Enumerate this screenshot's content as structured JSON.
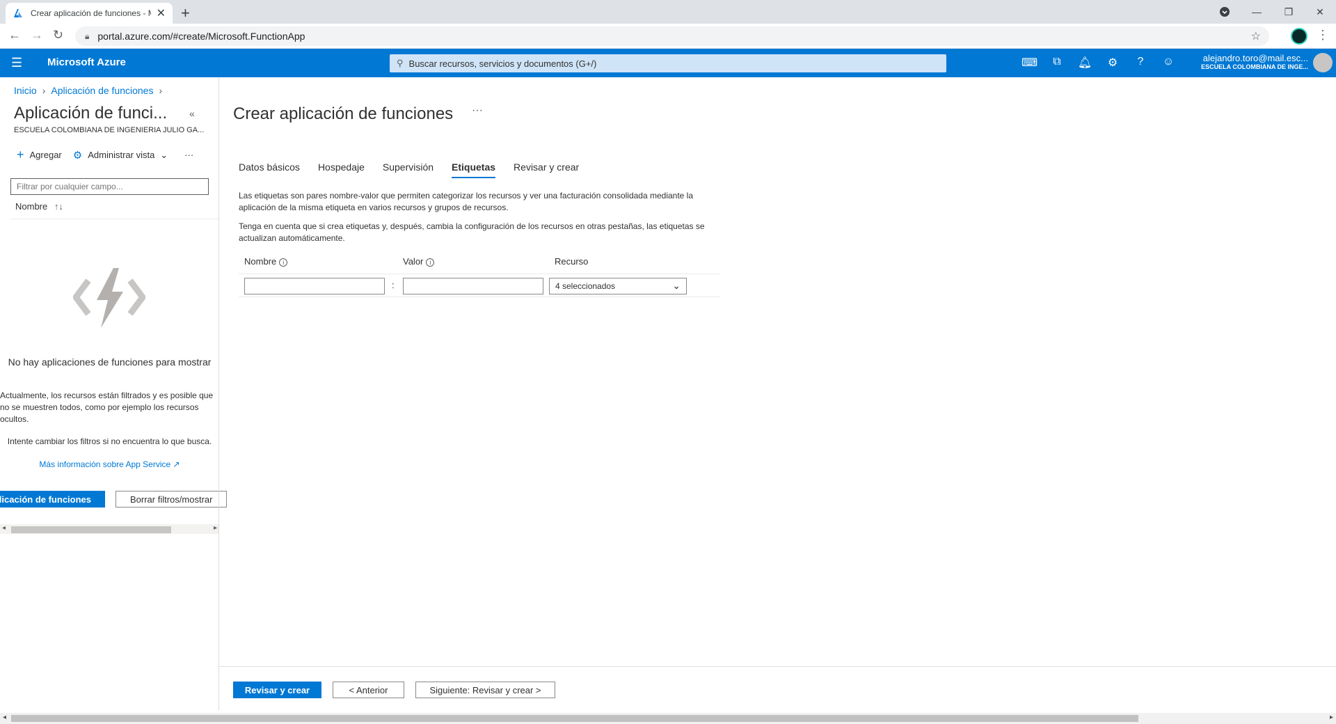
{
  "browser": {
    "tab_title": "Crear aplicación de funciones - M",
    "url": "portal.azure.com/#create/Microsoft.FunctionApp"
  },
  "header": {
    "brand": "Microsoft Azure",
    "search_placeholder": "Buscar recursos, servicios y documentos (G+/)",
    "user_email": "alejandro.toro@mail.esc...",
    "user_org": "ESCUELA COLOMBIANA DE INGE..."
  },
  "breadcrumb": [
    "Inicio",
    "Aplicación de funciones"
  ],
  "left": {
    "title": "Aplicación de funci...",
    "subtitle": "ESCUELA COLOMBIANA DE INGENIERIA JULIO GA...",
    "add_label": "Agregar",
    "manage_view_label": "Administrar vista",
    "filter_placeholder": "Filtrar por cualquier campo...",
    "column_name": "Nombre",
    "empty_title": "No hay aplicaciones de funciones para mostrar",
    "empty_desc": "Actualmente, los recursos están filtrados y es posible que no se muestren todos, como por ejemplo los recursos ocultos.",
    "empty_hint": "Intente cambiar los filtros si no encuentra lo que busca.",
    "learn_more": "Más información sobre App Service",
    "create_button": "plicación de funciones",
    "clear_button": "Borrar filtros/mostrar"
  },
  "main": {
    "title": "Crear aplicación de funciones",
    "tabs": [
      "Datos básicos",
      "Hospedaje",
      "Supervisión",
      "Etiquetas",
      "Revisar y crear"
    ],
    "active_tab": "Etiquetas",
    "desc1": "Las etiquetas son pares nombre-valor que permiten categorizar los recursos y ver una facturación consolidada mediante la aplicación de la misma etiqueta en varios recursos y grupos de recursos.",
    "desc2": "Tenga en cuenta que si crea etiquetas y, después, cambia la configuración de los recursos en otras pestañas, las etiquetas se actualizan automáticamente.",
    "col_name": "Nombre",
    "col_value": "Valor",
    "col_resource": "Recurso",
    "resource_selected": "4 seleccionados"
  },
  "footer": {
    "review_button": "Revisar y crear",
    "prev_button": "< Anterior",
    "next_button": "Siguiente: Revisar y crear >"
  },
  "icons": {
    "favicon": "azure-icon",
    "function_placeholder": "function-app-icon"
  }
}
